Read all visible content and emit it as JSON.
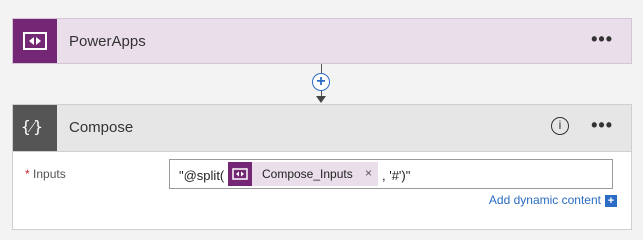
{
  "powerapps_card": {
    "title": "PowerApps",
    "more_label": "•••",
    "icon": "powerapps-icon",
    "color": "#742774"
  },
  "connector": {
    "plus": "+"
  },
  "compose_card": {
    "title": "Compose",
    "info_label": "i",
    "more_label": "•••",
    "icon": "braces-icon",
    "icon_glyph": "{⁄}",
    "inputs_label": "Inputs",
    "required_mark": "*",
    "expression_prefix": "\"@split(",
    "token_label": "Compose_Inputs",
    "token_remove": "×",
    "expression_suffix": ", '#')\"",
    "add_dynamic_content": "Add dynamic content",
    "add_button": "+"
  }
}
